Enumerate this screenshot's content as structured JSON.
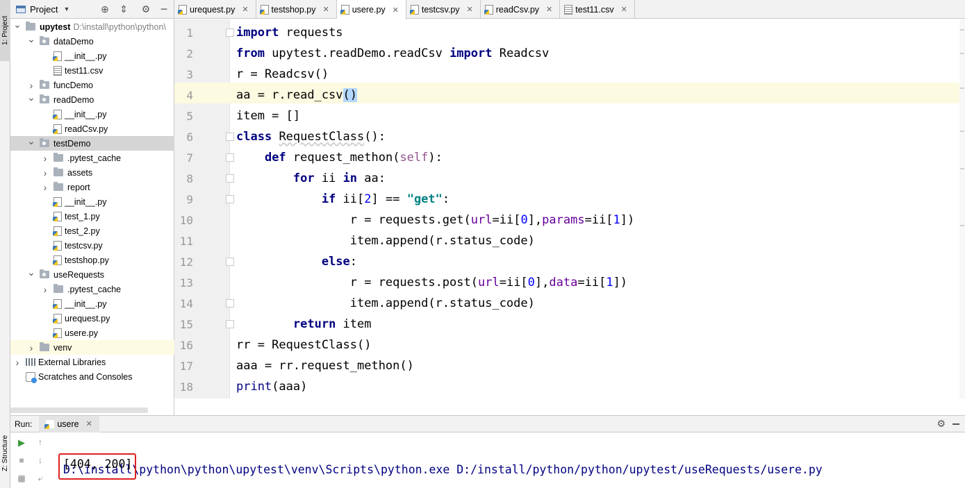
{
  "side_tabs": {
    "project": "1: Project",
    "structure": "Z: Structure"
  },
  "project_panel": {
    "title": "Project",
    "tree": [
      {
        "label": "upytest",
        "path": "D:\\install\\python\\python\\",
        "type": "project",
        "expanded": true
      },
      {
        "label": "dataDemo",
        "type": "folder",
        "expanded": true
      },
      {
        "label": "__init__.py",
        "type": "py"
      },
      {
        "label": "test11.csv",
        "type": "csv"
      },
      {
        "label": "funcDemo",
        "type": "folder",
        "expanded": false
      },
      {
        "label": "readDemo",
        "type": "folder",
        "expanded": true
      },
      {
        "label": "__init__.py",
        "type": "py"
      },
      {
        "label": "readCsv.py",
        "type": "py"
      },
      {
        "label": "testDemo",
        "type": "folder",
        "expanded": true,
        "selected": true
      },
      {
        "label": ".pytest_cache",
        "type": "folder",
        "expanded": false
      },
      {
        "label": "assets",
        "type": "folder",
        "expanded": false
      },
      {
        "label": "report",
        "type": "folder",
        "expanded": false
      },
      {
        "label": "__init__.py",
        "type": "py"
      },
      {
        "label": "test_1.py",
        "type": "py"
      },
      {
        "label": "test_2.py",
        "type": "py"
      },
      {
        "label": "testcsv.py",
        "type": "py"
      },
      {
        "label": "testshop.py",
        "type": "py"
      },
      {
        "label": "useRequests",
        "type": "folder",
        "expanded": true
      },
      {
        "label": ".pytest_cache",
        "type": "folder",
        "expanded": false
      },
      {
        "label": "__init__.py",
        "type": "py"
      },
      {
        "label": "urequest.py",
        "type": "py"
      },
      {
        "label": "usere.py",
        "type": "py"
      },
      {
        "label": "venv",
        "type": "folder",
        "expanded": false,
        "highlighted": true
      },
      {
        "label": "External Libraries",
        "type": "lib",
        "expanded": false
      },
      {
        "label": "Scratches and Consoles",
        "type": "scratch"
      }
    ]
  },
  "tabs": [
    {
      "label": "urequest.py",
      "type": "py"
    },
    {
      "label": "testshop.py",
      "type": "py"
    },
    {
      "label": "usere.py",
      "type": "py",
      "active": true
    },
    {
      "label": "testcsv.py",
      "type": "py"
    },
    {
      "label": "readCsv.py",
      "type": "py"
    },
    {
      "label": "test11.csv",
      "type": "csv"
    }
  ],
  "editor": {
    "line_numbers": [
      "1",
      "2",
      "3",
      "4",
      "5",
      "6",
      "7",
      "8",
      "9",
      "10",
      "11",
      "12",
      "13",
      "14",
      "15",
      "16",
      "17",
      "18"
    ],
    "current_line": 4
  },
  "run": {
    "label": "Run:",
    "config_name": "usere",
    "command": "D:\\install\\python\\python\\upytest\\venv\\Scripts\\python.exe D:/install/python/python/upytest/useRequests/usere.py",
    "result": "[404, 200]"
  },
  "colors": {
    "keyword": "#000080",
    "string": "#008080",
    "param": "#660099",
    "number": "#0000ff",
    "highlight_box": "#e02020"
  }
}
